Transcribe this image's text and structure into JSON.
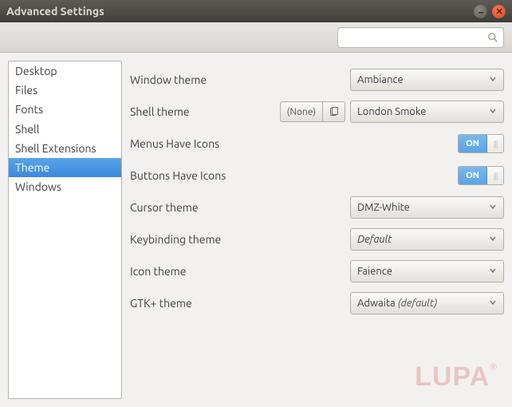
{
  "window": {
    "title": "Advanced Settings"
  },
  "search": {
    "value": "",
    "placeholder": ""
  },
  "sidebar": {
    "items": [
      {
        "label": "Desktop",
        "selected": false
      },
      {
        "label": "Files",
        "selected": false
      },
      {
        "label": "Fonts",
        "selected": false
      },
      {
        "label": "Shell",
        "selected": false
      },
      {
        "label": "Shell Extensions",
        "selected": false
      },
      {
        "label": "Theme",
        "selected": true
      },
      {
        "label": "Windows",
        "selected": false
      }
    ]
  },
  "settings": {
    "window_theme": {
      "label": "Window theme",
      "value": "Ambiance"
    },
    "shell_theme": {
      "label": "Shell theme",
      "aux_button": "(None)",
      "value": "London Smoke"
    },
    "menus_have_icons": {
      "label": "Menus Have Icons",
      "toggle_text": "ON",
      "value": true
    },
    "buttons_have_icons": {
      "label": "Buttons Have Icons",
      "toggle_text": "ON",
      "value": true
    },
    "cursor_theme": {
      "label": "Cursor theme",
      "value": "DMZ-White"
    },
    "keybinding_theme": {
      "label": "Keybinding theme",
      "value": "Default"
    },
    "icon_theme": {
      "label": "Icon theme",
      "value": "Faience"
    },
    "gtk_theme": {
      "label": "GTK+ theme",
      "value": "Adwaita",
      "suffix": "(default)"
    }
  },
  "watermark": "LUPA"
}
